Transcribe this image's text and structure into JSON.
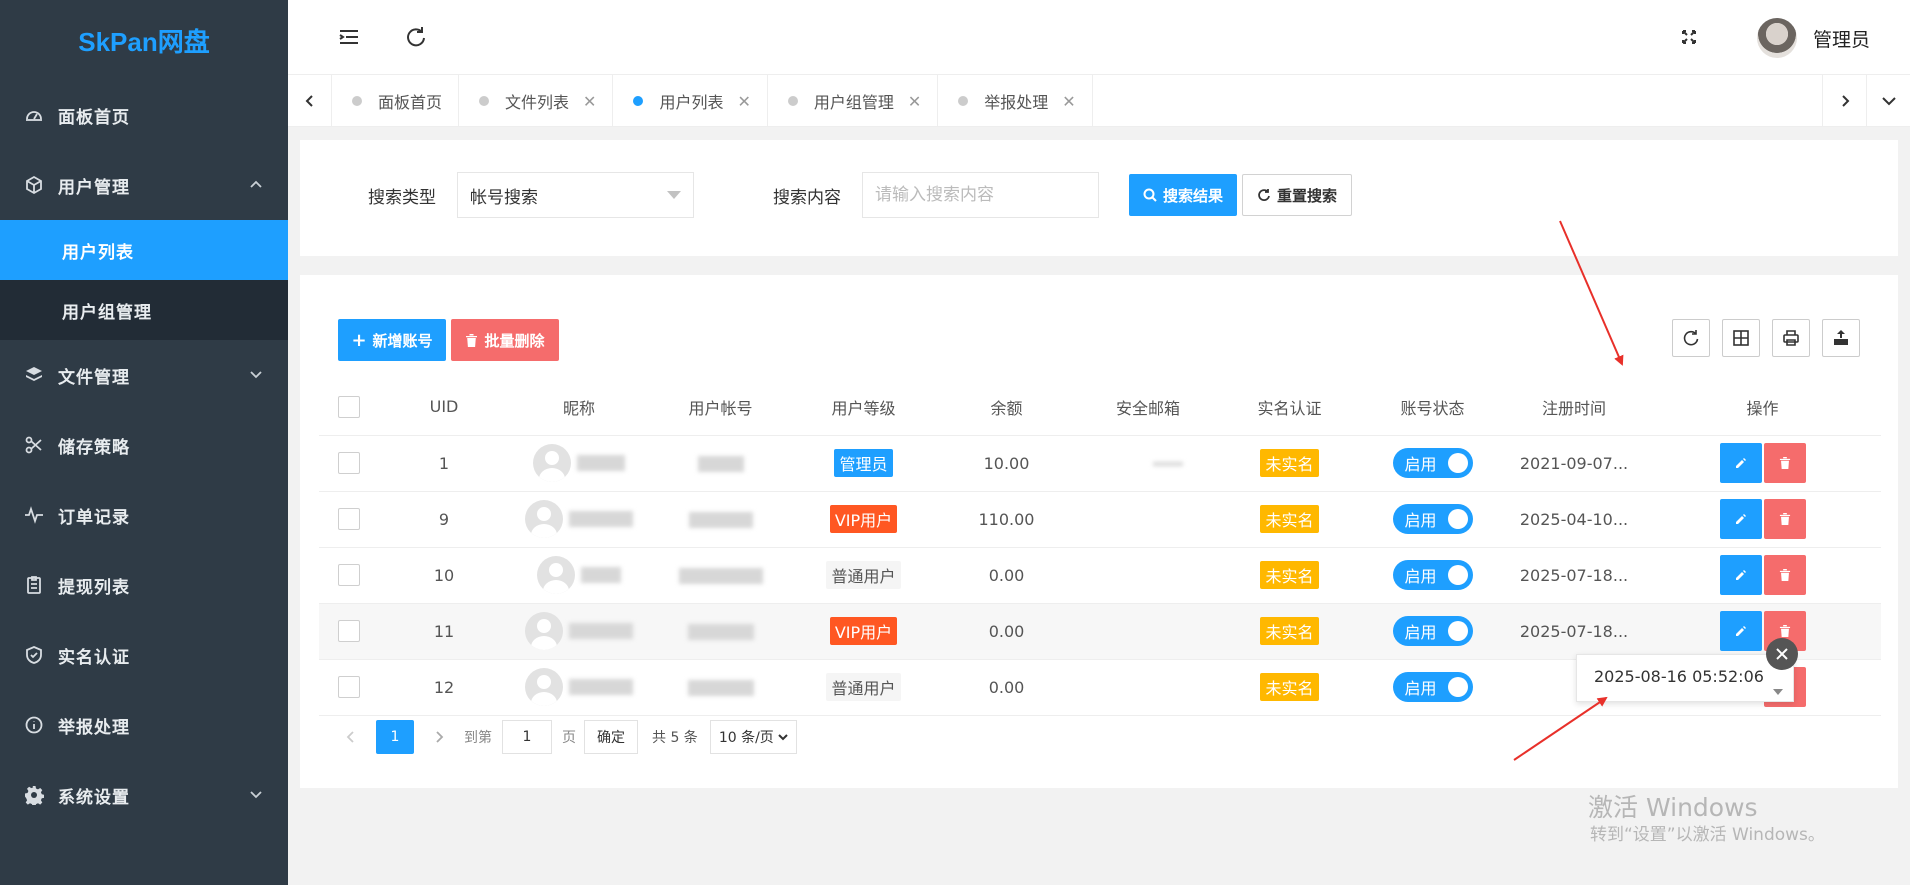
{
  "app": {
    "brand": "SkPan网盘"
  },
  "sidebar": {
    "items": [
      {
        "label": "面板首页",
        "icon": "dashboard-icon"
      },
      {
        "label": "用户管理",
        "icon": "box-icon",
        "expanded": true,
        "children": [
          {
            "label": "用户列表",
            "active": true
          },
          {
            "label": "用户组管理"
          }
        ]
      },
      {
        "label": "文件管理",
        "icon": "layers-icon"
      },
      {
        "label": "储存策略",
        "icon": "scissors-icon"
      },
      {
        "label": "订单记录",
        "icon": "pulse-icon"
      },
      {
        "label": "提现列表",
        "icon": "clipboard-icon"
      },
      {
        "label": "实名认证",
        "icon": "shield-check-icon"
      },
      {
        "label": "举报处理",
        "icon": "info-icon"
      },
      {
        "label": "系统设置",
        "icon": "gear-icon"
      }
    ]
  },
  "header": {
    "user_name": "管理员"
  },
  "tabs": [
    {
      "label": "面板首页",
      "closable": false
    },
    {
      "label": "文件列表",
      "closable": true
    },
    {
      "label": "用户列表",
      "closable": true,
      "active": true
    },
    {
      "label": "用户组管理",
      "closable": true
    },
    {
      "label": "举报处理",
      "closable": true
    }
  ],
  "search": {
    "type_label": "搜索类型",
    "type_value": "帐号搜索",
    "content_label": "搜索内容",
    "content_placeholder": "请输入搜索内容",
    "search_button": "搜索结果",
    "reset_button": "重置搜索"
  },
  "toolbar": {
    "add_button": "新增账号",
    "batch_delete_button": "批量删除"
  },
  "table": {
    "columns": [
      "UID",
      "昵称",
      "用户帐号",
      "用户等级",
      "余额",
      "安全邮箱",
      "实名认证",
      "账号状态",
      "注册时间",
      "操作"
    ],
    "rows": [
      {
        "uid": "1",
        "level": "管理员",
        "level_style": "blue",
        "balance": "10.00",
        "realname": "未实名",
        "status": "启用",
        "reg_time": "2021-09-07..."
      },
      {
        "uid": "9",
        "level": "VIP用户",
        "level_style": "red",
        "balance": "110.00",
        "realname": "未实名",
        "status": "启用",
        "reg_time": "2025-04-10..."
      },
      {
        "uid": "10",
        "level": "普通用户",
        "level_style": "gray",
        "balance": "0.00",
        "realname": "未实名",
        "status": "启用",
        "reg_time": "2025-07-18..."
      },
      {
        "uid": "11",
        "level": "VIP用户",
        "level_style": "red",
        "balance": "0.00",
        "realname": "未实名",
        "status": "启用",
        "reg_time": "2025-07-18..."
      },
      {
        "uid": "12",
        "level": "普通用户",
        "level_style": "gray",
        "balance": "0.00",
        "realname": "未实名",
        "status": "启用",
        "reg_time": ""
      }
    ]
  },
  "tooltip": {
    "text": "2025-08-16 05:52:06"
  },
  "pagination": {
    "current_page": "1",
    "goto_label": "到第",
    "goto_value": "1",
    "page_unit": "页",
    "confirm": "确定",
    "total": "共 5 条",
    "page_size": "10 条/页"
  },
  "watermark": {
    "line1": "激活 Windows",
    "line2": "转到“设置”以激活 Windows。"
  }
}
